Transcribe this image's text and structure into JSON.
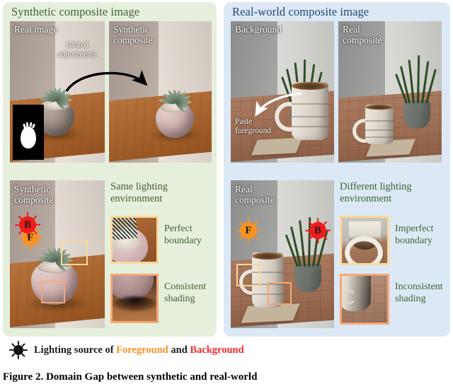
{
  "figure": {
    "caption": "Figure 2.  Domain Gap between synthetic and real-world"
  },
  "panels": {
    "synthetic": {
      "title": "Synthetic composite image",
      "bg_color": "#e6efdc",
      "title_color": "#3f6331",
      "tiles": [
        {
          "label": "Real image",
          "note": "Global\nadjustments",
          "has_mask_inset": true
        },
        {
          "label": "Synthetic\ncomposite"
        }
      ],
      "bottom": {
        "scene_label": "Synthetic\ncomposite",
        "heading": "Same lighting\nenvironment",
        "suns": [
          {
            "letter": "B",
            "color": "#f01b1b"
          },
          {
            "letter": "F",
            "color": "#f79224"
          }
        ],
        "thumbs": [
          {
            "caption": "Perfect\nboundary",
            "border_color": "#fbd89a"
          },
          {
            "caption": "Consistent\nshading",
            "border_color": "#f5a878"
          }
        ]
      }
    },
    "real": {
      "title": "Real-world composite image",
      "bg_color": "#dce8f6",
      "title_color": "#24456f",
      "tiles": [
        {
          "label": "Background",
          "note": "Paste\nforeground"
        },
        {
          "label": "Real\ncomposite"
        }
      ],
      "bottom": {
        "scene_label": "Real\ncomposite",
        "heading": "Different lighting\nenvironment",
        "suns": [
          {
            "letter": "F",
            "color": "#f79224"
          },
          {
            "letter": "B",
            "color": "#f01b1b"
          }
        ],
        "thumbs": [
          {
            "caption": "Imperfect\nboundary",
            "border_color": "#fbd89a"
          },
          {
            "caption": "Inconsistent\nshading",
            "border_color": "#f5a878"
          }
        ]
      }
    }
  },
  "legend": {
    "icon": "sun-icon",
    "prefix": "Lighting source of ",
    "foreground": "Foreground",
    "middle": " and ",
    "background": "Background",
    "foreground_color": "#f79224",
    "background_color": "#fa2a2a"
  }
}
